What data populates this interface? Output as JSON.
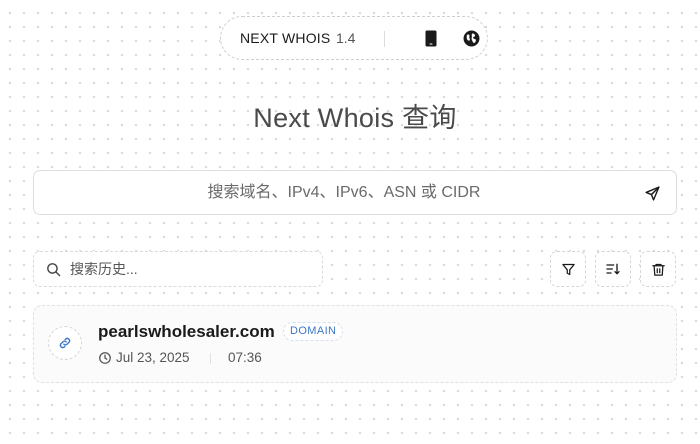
{
  "header": {
    "brand": "NEXT WHOIS",
    "version": "1.4",
    "icons": [
      "phone-icon",
      "globe-icon"
    ]
  },
  "title": "Next Whois 查询",
  "search": {
    "placeholder": "搜索域名、IPv4、IPv6、ASN 或 CIDR",
    "value": "",
    "submit_icon": "send-icon"
  },
  "history": {
    "search_placeholder": "搜索历史...",
    "search_value": "",
    "toolbar_icons": [
      "filter-icon",
      "sort-icon",
      "trash-icon"
    ],
    "items": [
      {
        "domain": "pearlswholesaler.com",
        "type": "DOMAIN",
        "date": "Jul 23, 2025",
        "time": "07:36",
        "icon": "link-icon"
      }
    ]
  },
  "colors": {
    "accent": "#3b78c7",
    "text": "#1a1a1a",
    "muted": "#555555",
    "border": "#dedede"
  }
}
